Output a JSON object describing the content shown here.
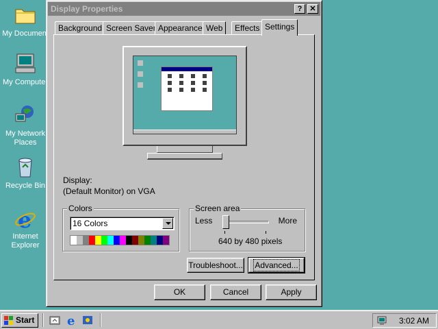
{
  "desktop": {
    "icons": [
      {
        "label": "My Document",
        "icon": "folder-icon"
      },
      {
        "label": "My Computer",
        "icon": "computer-icon"
      },
      {
        "label": "My Network Places",
        "icon": "network-icon"
      },
      {
        "label": "Recycle Bin",
        "icon": "recycle-bin-icon"
      },
      {
        "label": "Internet Explorer",
        "icon": "ie-icon"
      }
    ]
  },
  "window": {
    "title": "Display Properties",
    "help_label": "?",
    "close_label": "✕",
    "tabs": [
      "Background",
      "Screen Saver",
      "Appearance",
      "Web",
      "Effects",
      "Settings"
    ],
    "active_tab": "Settings",
    "display_label": "Display:",
    "display_value": "(Default Monitor) on VGA",
    "colors": {
      "group_label": "Colors",
      "selected": "16 Colors",
      "palette": [
        "#ffffff",
        "#c0c0c0",
        "#808080",
        "#ff0000",
        "#ffff00",
        "#00ff00",
        "#00ffff",
        "#0000ff",
        "#ff00ff",
        "#000000",
        "#800000",
        "#808000",
        "#008000",
        "#008080",
        "#000080",
        "#800080"
      ]
    },
    "screen_area": {
      "group_label": "Screen area",
      "less_label": "Less",
      "more_label": "More",
      "value_text": "640 by 480 pixels",
      "slider_fraction": 0.0
    },
    "buttons": {
      "troubleshoot": "Troubleshoot...",
      "advanced": "Advanced...",
      "ok": "OK",
      "cancel": "Cancel",
      "apply": "Apply"
    }
  },
  "taskbar": {
    "start_label": "Start",
    "quick_launch": [
      "desktop-icon",
      "ie-icon",
      "channels-icon"
    ],
    "clock": "3:02 AM"
  },
  "colors": {
    "desktop_bg": "#55aaaa",
    "title_inactive": "#808080",
    "face": "#c0c0c0"
  }
}
